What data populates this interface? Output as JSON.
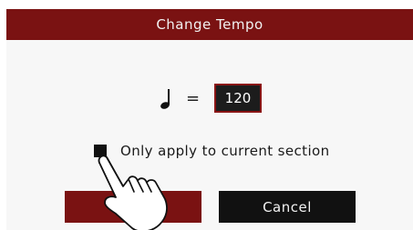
{
  "dialog": {
    "title": "Change Tempo"
  },
  "tempo": {
    "note_icon": "quarter-note-icon",
    "equals": "=",
    "value": "120"
  },
  "option": {
    "label": "Only apply to current section",
    "checked": true
  },
  "buttons": {
    "ok_label": "",
    "cancel_label": "Cancel"
  },
  "overlay": {
    "icon": "tapping-hand-icon"
  },
  "colors": {
    "title_bar": "#7a1212",
    "ok_button": "#7a1212",
    "cancel_button": "#111111",
    "field_border": "#8a1515"
  }
}
